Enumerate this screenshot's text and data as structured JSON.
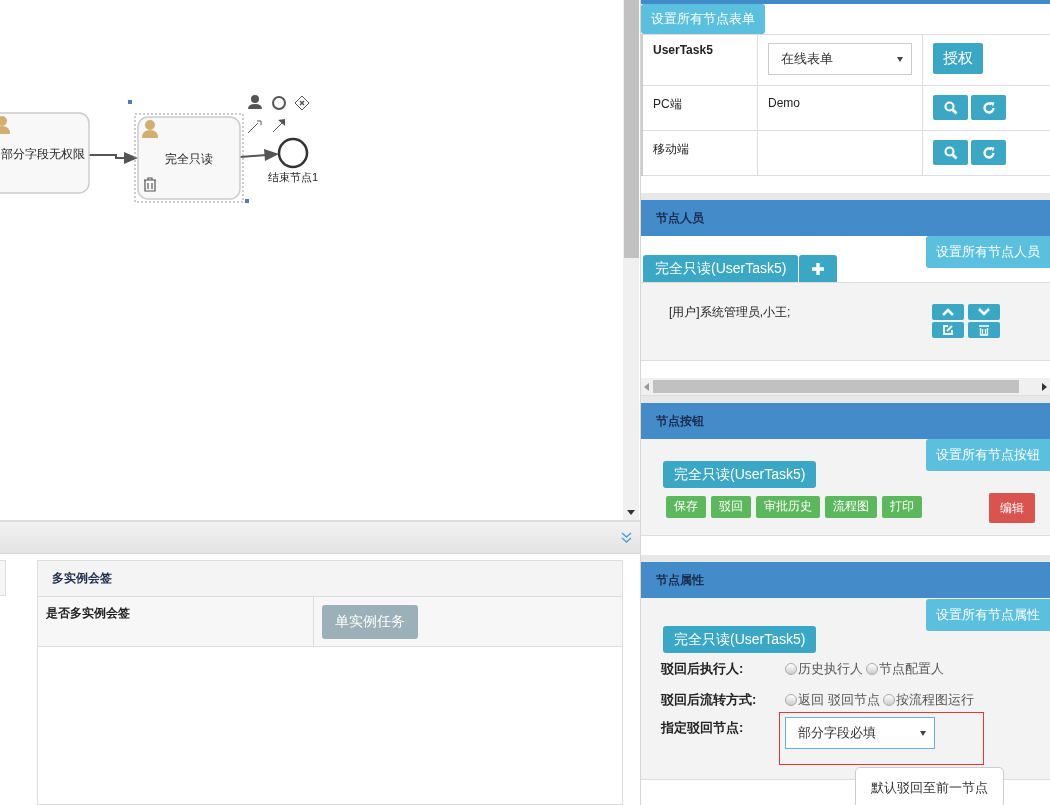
{
  "diagram": {
    "nodes": [
      {
        "kind": "task",
        "label": "部分字段无权限",
        "selected": false
      },
      {
        "kind": "task",
        "label": "完全只读",
        "selected": true
      },
      {
        "kind": "end",
        "label": "结束节点1"
      }
    ]
  },
  "multi_instance": {
    "title": "多实例会签",
    "row_label": "是否多实例会签",
    "button": "单实例任务"
  },
  "form_section": {
    "set_all_button": "设置所有节点表单",
    "task_name": "UserTask5",
    "form_type": "在线表单",
    "authorize_button": "授权",
    "rows": [
      {
        "label": "PC端",
        "value": "Demo"
      },
      {
        "label": "移动端"
      }
    ]
  },
  "personnel": {
    "title": "节点人员",
    "set_all_button": "设置所有节点人员",
    "tabs": [
      {
        "label": "完全只读(UserTask5)",
        "selected": true
      }
    ],
    "entries": [
      "[用户]系统管理员,小王;"
    ]
  },
  "node_buttons": {
    "title": "节点按钮",
    "set_all_button": "设置所有节点按钮",
    "task_tag": "完全只读(UserTask5)",
    "buttons": [
      "保存",
      "驳回",
      "审批历史",
      "流程图",
      "打印"
    ],
    "edit_button": "编辑"
  },
  "properties": {
    "title": "节点属性",
    "set_all_button": "设置所有节点属性",
    "task_tag": "完全只读(UserTask5)",
    "fields": [
      {
        "kind": "radio",
        "label": "驳回后执行人:",
        "options": [
          {
            "label": "历史执行人",
            "selected": false
          },
          {
            "label": "节点配置人",
            "selected": false
          }
        ]
      },
      {
        "kind": "radio",
        "label": "驳回后流转方式:",
        "options": [
          {
            "label": "返回 驳回节点",
            "selected": false
          },
          {
            "label": "按流程图运行",
            "selected": false
          }
        ]
      },
      {
        "kind": "select",
        "label": "指定驳回节点:",
        "value": "部分字段必填",
        "highlighted": true
      }
    ],
    "tooltip": "默认驳回至前一节点"
  }
}
